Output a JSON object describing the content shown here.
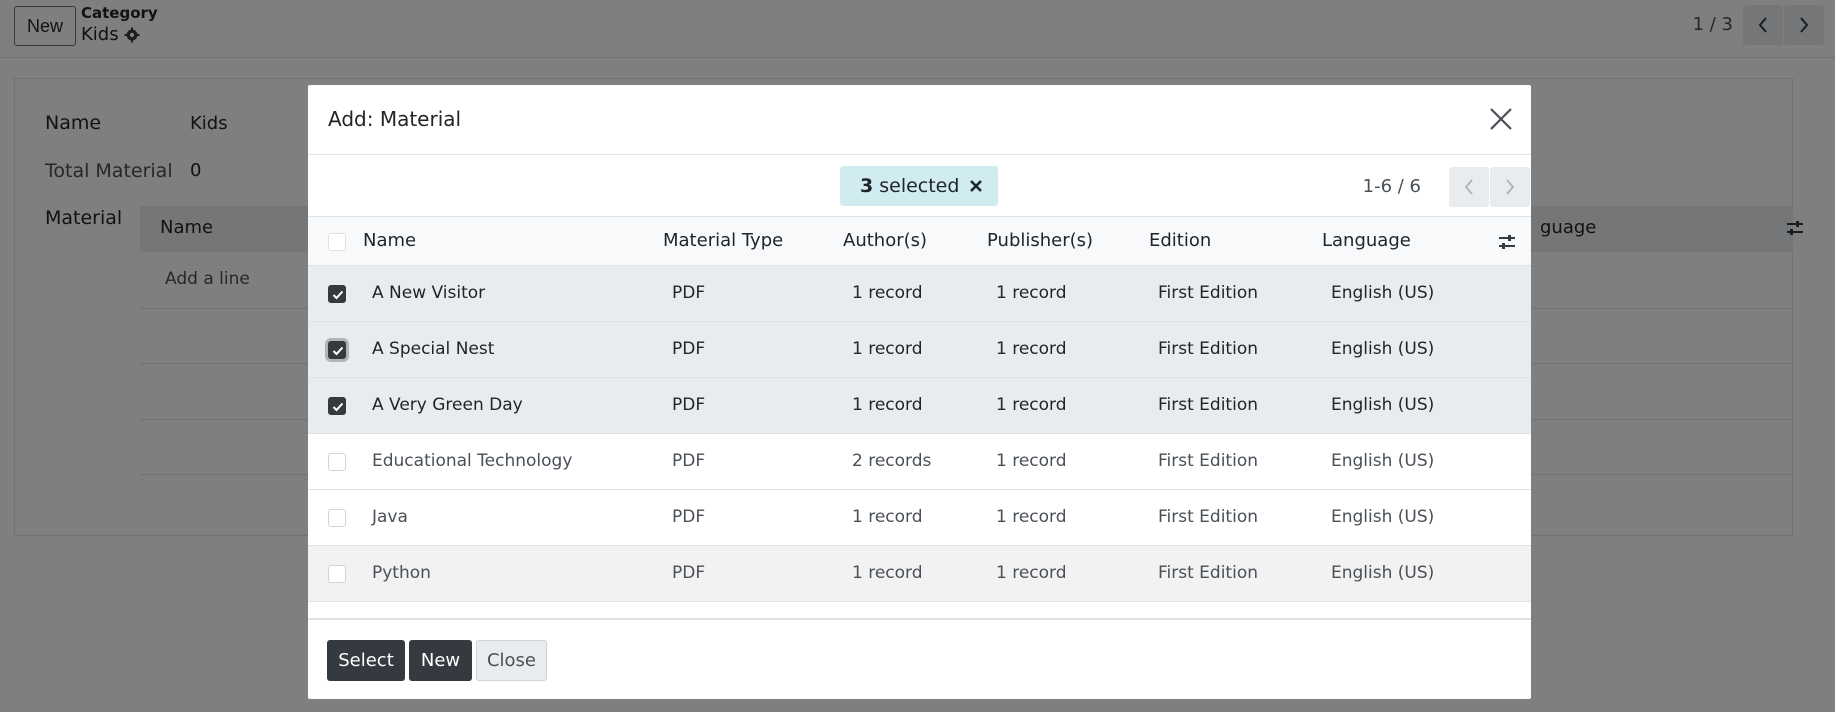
{
  "background": {
    "new_label": "New",
    "breadcrumb_parent": "Category",
    "breadcrumb_current": "Kids",
    "pager": "1 / 3",
    "fields": {
      "name_label": "Name",
      "name_value": "Kids",
      "total_label": "Total Material",
      "total_value": "0",
      "material_label": "Material"
    },
    "table": {
      "col_name": "Name",
      "col_language_partial": "guage",
      "add_line": "Add a line"
    }
  },
  "modal": {
    "title": "Add: Material",
    "selected_count": "3",
    "selected_text": "selected",
    "pager": "1-6 / 6",
    "columns": [
      "Name",
      "Material Type",
      "Author(s)",
      "Publisher(s)",
      "Edition",
      "Language"
    ],
    "rows": [
      {
        "name": "A New Visitor",
        "type": "PDF",
        "authors": "1 record",
        "publishers": "1 record",
        "edition": "First Edition",
        "language": "English (US)",
        "checked": true
      },
      {
        "name": "A Special Nest",
        "type": "PDF",
        "authors": "1 record",
        "publishers": "1 record",
        "edition": "First Edition",
        "language": "English (US)",
        "checked": true
      },
      {
        "name": "A Very Green Day",
        "type": "PDF",
        "authors": "1 record",
        "publishers": "1 record",
        "edition": "First Edition",
        "language": "English (US)",
        "checked": true
      },
      {
        "name": "Educational Technology",
        "type": "PDF",
        "authors": "2 records",
        "publishers": "1 record",
        "edition": "First Edition",
        "language": "English (US)",
        "checked": false
      },
      {
        "name": "Java",
        "type": "PDF",
        "authors": "1 record",
        "publishers": "1 record",
        "edition": "First Edition",
        "language": "English (US)",
        "checked": false
      },
      {
        "name": "Python",
        "type": "PDF",
        "authors": "1 record",
        "publishers": "1 record",
        "edition": "First Edition",
        "language": "English (US)",
        "checked": false
      }
    ],
    "buttons": {
      "select": "Select",
      "new": "New",
      "close": "Close"
    }
  },
  "colors": {
    "selected_badge": "#d1ecf1",
    "primary_dark": "#343a40",
    "overlay": "rgba(0,0,0,0.5)"
  }
}
